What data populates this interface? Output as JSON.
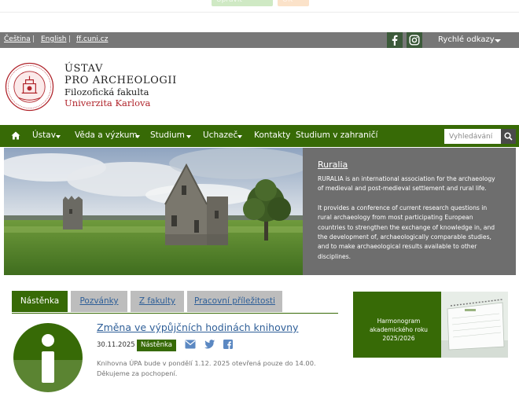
{
  "notice": {
    "accept_label": "Upravit ukládání",
    "ok_label": "OK"
  },
  "utility": {
    "lang_cs": "Čeština",
    "lang_en": "English",
    "site_link": "ff.cuni.cz",
    "separator": "|",
    "quick_links": "Rychlé odkazy",
    "facebook_icon": "facebook-icon",
    "instagram_icon": "instagram-icon"
  },
  "logo": {
    "line1": "ÚSTAV",
    "line2": "PRO ARCHEOLOGII",
    "line3": "Filozofická fakulta",
    "line4": "Univerzita Karlova"
  },
  "nav": {
    "home_icon": "home-icon",
    "items": [
      "Ústav",
      "Věda a výzkum",
      "Studium",
      "Uchazeč",
      "Kontakty",
      "Studium v zahraničí"
    ],
    "search_placeholder": "Vyhledávání"
  },
  "hero": {
    "link": "Ruralia",
    "paragraph1": "RURALIA is an international association for the archaeology of medieval and post-medieval settlement and rural life.",
    "paragraph2": "It provides a conference of current research questions in rural archaeology from most participating European countries to strengthen the exchange of knowledge in, and the development of, archaeologically comparable studies, and to make archaeological results available to other disciplines."
  },
  "tabs": [
    "Nástěnka",
    "Pozvánky",
    "Z fakulty",
    "Pracovní příležitosti"
  ],
  "news": {
    "title": "Změna ve výpůjčních hodinách knihovny",
    "date": "30.11.2025",
    "badge": "Nástěnka",
    "text": "Knihovna ÚPA bude v pondělí 1.12. 2025 otevřená pouze do 14.00. Děkujeme za pochopení."
  },
  "banner": {
    "text": "Harmonogram akademického roku 2025/2026"
  },
  "colors": {
    "brand_green": "#376a06",
    "utility_grey": "#777777",
    "link_blue": "#2f5f98",
    "university_red": "#b0242b"
  }
}
